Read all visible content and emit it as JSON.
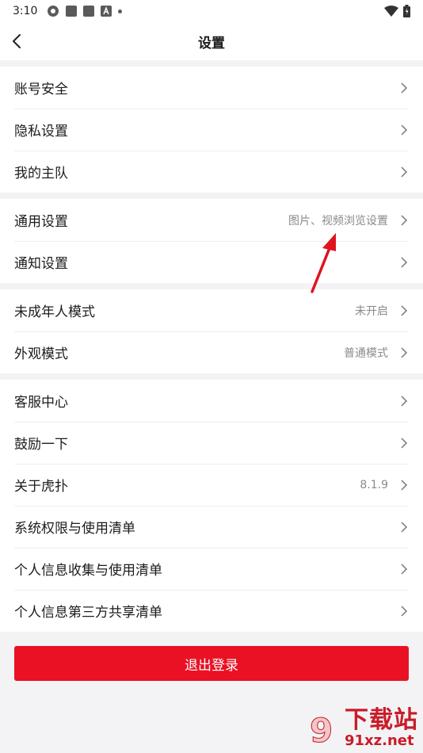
{
  "status": {
    "time": "3:10"
  },
  "header": {
    "title": "设置"
  },
  "groups": [
    {
      "items": [
        {
          "label": "账号安全",
          "value": ""
        },
        {
          "label": "隐私设置",
          "value": ""
        },
        {
          "label": "我的主队",
          "value": ""
        }
      ]
    },
    {
      "items": [
        {
          "label": "通用设置",
          "value": "图片、视频浏览设置"
        },
        {
          "label": "通知设置",
          "value": ""
        }
      ]
    },
    {
      "items": [
        {
          "label": "未成年人模式",
          "value": "未开启"
        },
        {
          "label": "外观模式",
          "value": "普通模式"
        }
      ]
    },
    {
      "items": [
        {
          "label": "客服中心",
          "value": ""
        },
        {
          "label": "鼓励一下",
          "value": ""
        },
        {
          "label": "关于虎扑",
          "value": "8.1.9"
        },
        {
          "label": "系统权限与使用清单",
          "value": ""
        },
        {
          "label": "个人信息收集与使用清单",
          "value": ""
        },
        {
          "label": "个人信息第三方共享清单",
          "value": ""
        }
      ]
    }
  ],
  "logout": {
    "label": "退出登录"
  },
  "watermark": {
    "text": "下载站",
    "url": "91xz.net"
  },
  "colors": {
    "accent": "#ea1124",
    "background": "#f3f3f5",
    "annotation_arrow": "#e0141e"
  }
}
